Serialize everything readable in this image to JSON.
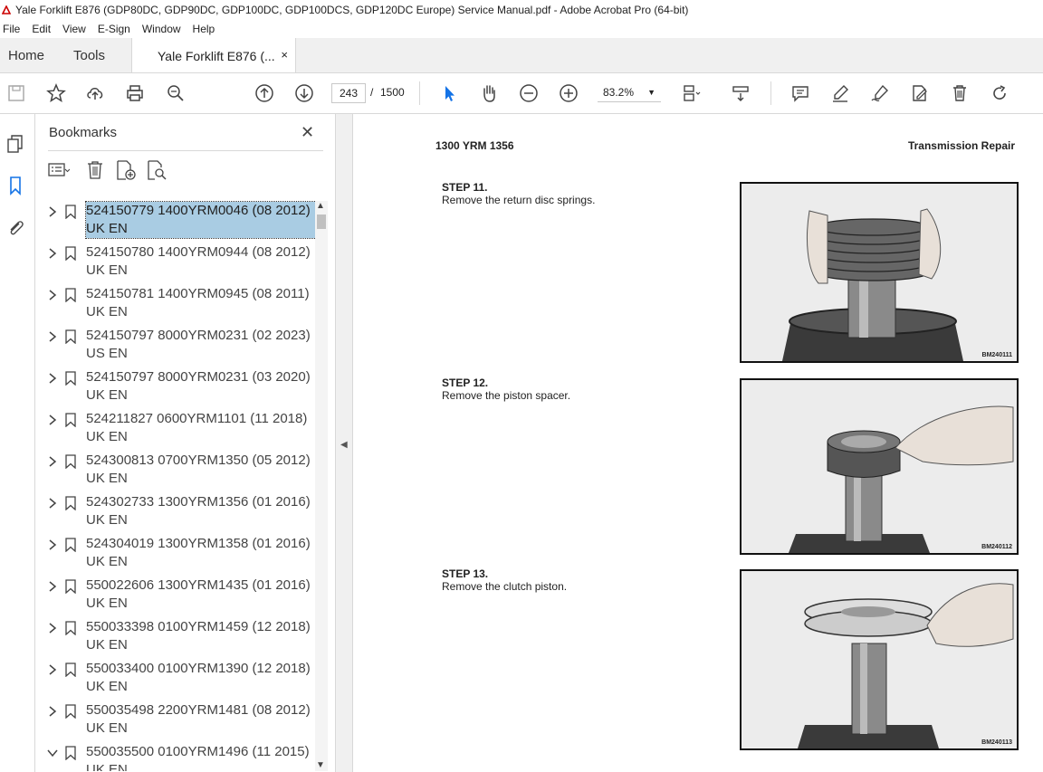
{
  "window": {
    "title": "Yale Forklift E876 (GDP80DC, GDP90DC, GDP100DC, GDP100DCS, GDP120DC Europe) Service Manual.pdf - Adobe Acrobat Pro (64-bit)"
  },
  "menu": [
    "File",
    "Edit",
    "View",
    "E-Sign",
    "Window",
    "Help"
  ],
  "tabs": {
    "home": "Home",
    "tools": "Tools",
    "document": "Yale Forklift E876 (...",
    "close": "×"
  },
  "toolbar": {
    "page_current": "243",
    "page_separator": "/",
    "page_total": "1500",
    "zoom": "83.2%"
  },
  "bookmarks": {
    "title": "Bookmarks",
    "items": [
      {
        "line1": "524150779 1400YRM0046 (08 2012)",
        "line2": "UK EN",
        "selected": true
      },
      {
        "line1": "524150780 1400YRM0944 (08 2012)",
        "line2": "UK EN"
      },
      {
        "line1": "524150781 1400YRM0945 (08 2011)",
        "line2": "UK EN"
      },
      {
        "line1": "524150797 8000YRM0231 (02 2023)",
        "line2": "US EN"
      },
      {
        "line1": "524150797 8000YRM0231 (03 2020)",
        "line2": "UK EN"
      },
      {
        "line1": "524211827 0600YRM1101 (11 2018)",
        "line2": "UK EN"
      },
      {
        "line1": "524300813 0700YRM1350 (05 2012)",
        "line2": "UK EN"
      },
      {
        "line1": "524302733 1300YRM1356 (01 2016)",
        "line2": "UK EN"
      },
      {
        "line1": "524304019 1300YRM1358 (01 2016)",
        "line2": "UK EN"
      },
      {
        "line1": "550022606 1300YRM1435 (01 2016)",
        "line2": "UK EN"
      },
      {
        "line1": "550033398 0100YRM1459 (12 2018)",
        "line2": "UK EN"
      },
      {
        "line1": "550033400 0100YRM1390 (12 2018)",
        "line2": "UK EN"
      },
      {
        "line1": "550035498 2200YRM1481 (08 2012)",
        "line2": "UK EN"
      },
      {
        "line1": "550035500 0100YRM1496 (11 2015)",
        "line2": "UK EN",
        "expanded": true
      }
    ]
  },
  "document": {
    "header_left": "1300 YRM 1356",
    "header_right": "Transmission Repair",
    "steps": [
      {
        "title": "STEP 11.",
        "text": "Remove the return disc springs.",
        "figure": "BM240111"
      },
      {
        "title": "STEP 12.",
        "text": "Remove the piston spacer.",
        "figure": "BM240112"
      },
      {
        "title": "STEP 13.",
        "text": "Remove the clutch piston.",
        "figure": "BM240113"
      }
    ]
  }
}
